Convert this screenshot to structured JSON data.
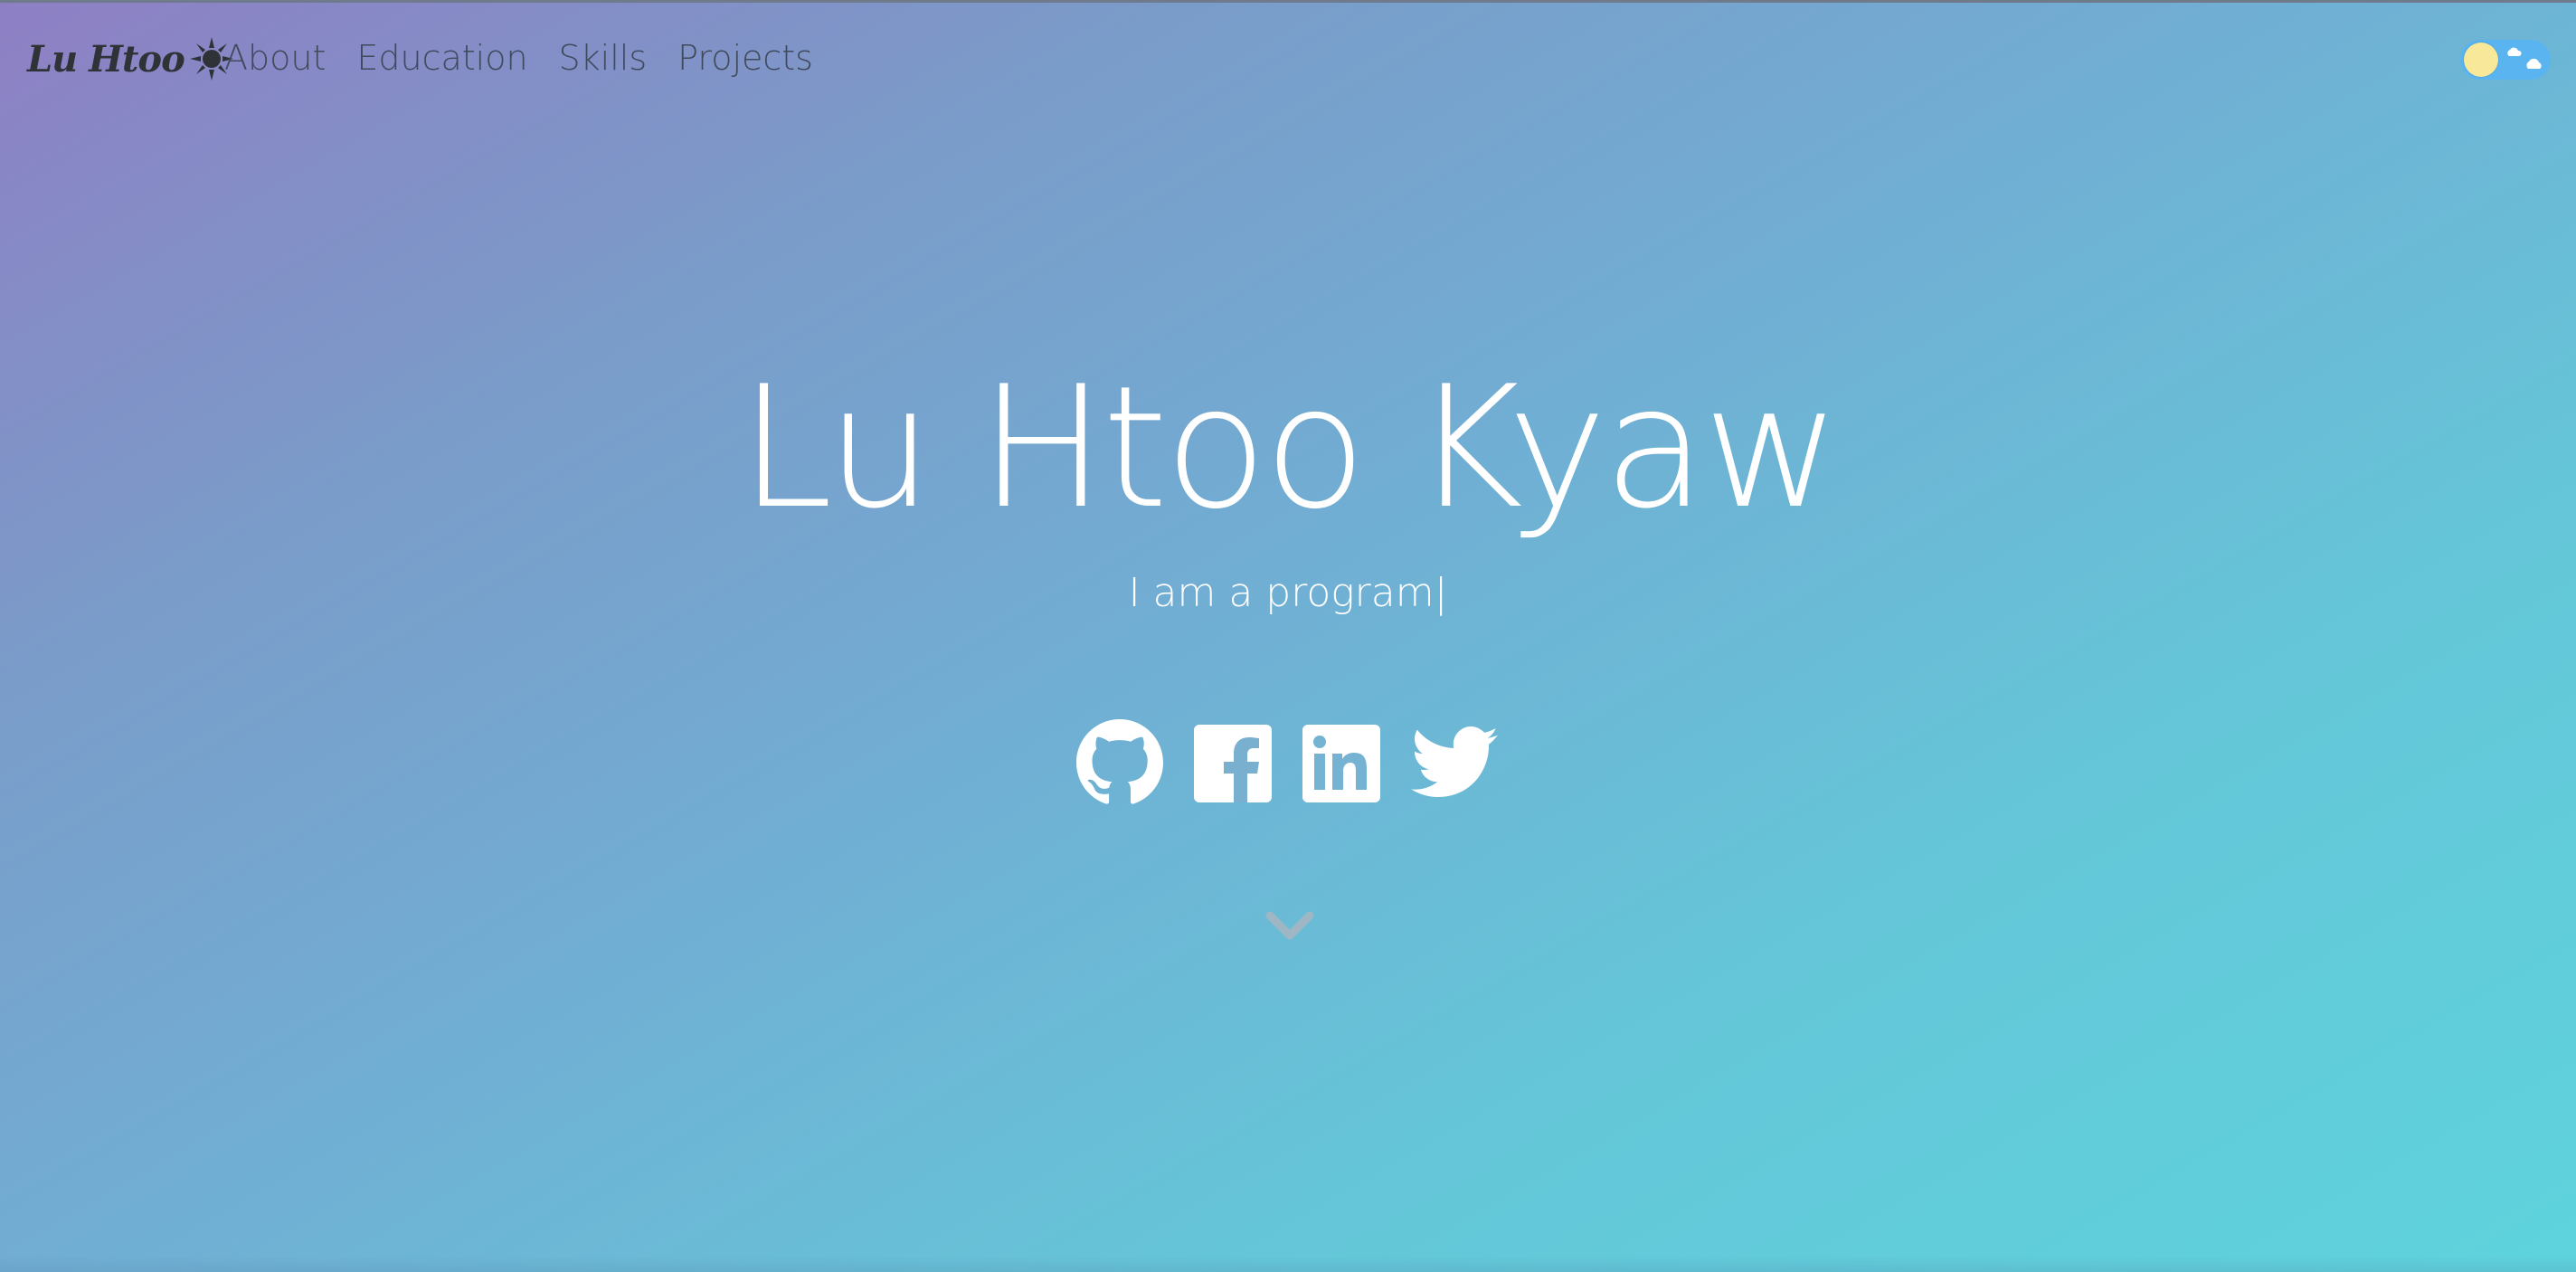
{
  "navbar": {
    "brand_label": "Lu Htoo",
    "brand_icon": "sun-icon",
    "links": [
      {
        "label": "About"
      },
      {
        "label": "Education"
      },
      {
        "label": "Skills"
      },
      {
        "label": "Projects"
      }
    ],
    "theme_toggle": {
      "state": "light",
      "knob_icon": "sun-icon",
      "track_icon": "cloud-icon"
    }
  },
  "hero": {
    "title": "Lu Htoo Kyaw",
    "tagline": "I am a program|",
    "social_links": [
      {
        "icon": "github-icon"
      },
      {
        "icon": "facebook-icon"
      },
      {
        "icon": "linkedin-icon"
      },
      {
        "icon": "twitter-icon"
      }
    ],
    "scroll_icon": "chevron-down-icon"
  },
  "colors": {
    "gradient_start": "#8e7fc4",
    "gradient_mid": "#72acd3",
    "gradient_end": "#5ed3dd",
    "nav_text": "#3f4a5c",
    "hero_text": "#ffffff",
    "toggle_track": "#5ab4ef",
    "toggle_knob": "#f7e89a"
  }
}
